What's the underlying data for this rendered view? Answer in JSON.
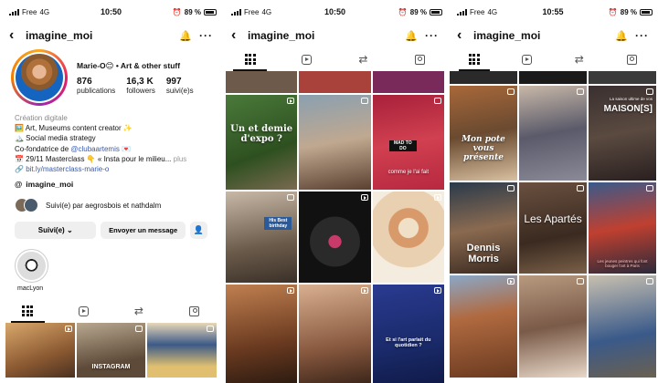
{
  "status_bar": {
    "carrier": "Free",
    "network": "4G",
    "battery": "89 %",
    "times": [
      "10:50",
      "10:50",
      "10:55"
    ]
  },
  "header": {
    "username": "imagine_moi",
    "back_icon": "chevron-left-icon",
    "bell_icon": "bell-icon",
    "more_icon": "more-dots-icon"
  },
  "profile": {
    "display_name": "Marie-O😊 • Art & other stuff",
    "stats": [
      {
        "value": "876",
        "label": "publications"
      },
      {
        "value": "16,3 K",
        "label": "followers"
      },
      {
        "value": "997",
        "label": "suivi(e)s"
      }
    ],
    "category": "Création digitale",
    "bio_lines": [
      "🖼️ Art, Museums content creator ✨",
      "🏔️ Social media strategy"
    ],
    "cofounder_prefix": "Co-fondatrice de ",
    "cofounder_mention": "@clubaartemis",
    "cofounder_suffix": " 💌",
    "masterclass_line": "📅 29/11 Masterclass 👇 « Insta pour le milieu...",
    "more_label": " plus",
    "link": "bit.ly/masterclass-marie-o",
    "threads_handle": "imagine_moi",
    "followed_by": "Suivi(e) par aegrosbois et nathdalm",
    "follow_button": "Suivi(e)",
    "message_button": "Envoyer un message",
    "highlight_label": "macLyon"
  },
  "grid_texts": {
    "expo": "Un et demie d'expo ?",
    "instagram": "INSTAGRAM",
    "mad": "MAD TO DO",
    "comme": "comme je l'ai fait",
    "birthday": "His Best birthday",
    "question": "Et si l'art parlait du quotidien ?",
    "dennis": "Dennis Morris",
    "apartes": "Les Apartés",
    "maison": "MAISON[S]",
    "maison_sub": "La saison ultime de vos",
    "jeunes": "Les jeunes peintres qui font bouger l'art à Paris",
    "pote": "Mon pote vous présente"
  }
}
